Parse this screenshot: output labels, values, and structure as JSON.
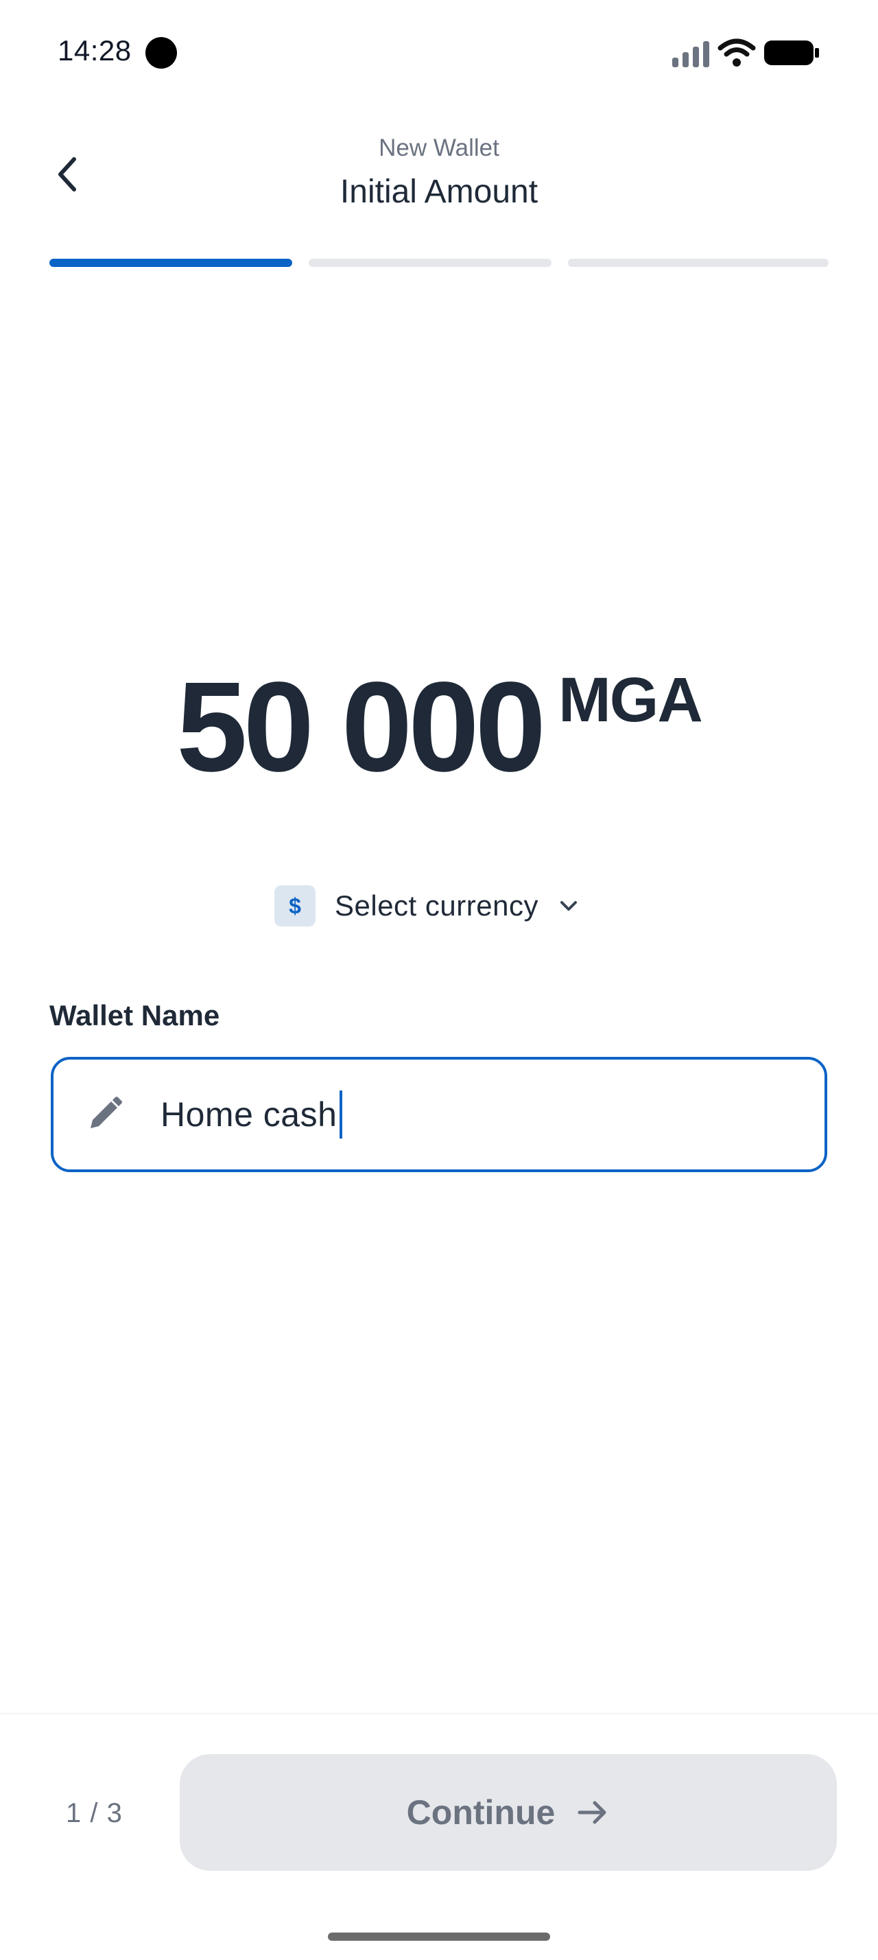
{
  "status_bar": {
    "time": "14:28"
  },
  "header": {
    "subtitle": "New Wallet",
    "title": "Initial Amount"
  },
  "progress": {
    "current_step": 1,
    "total_steps": 3
  },
  "amount": {
    "value": "50 000",
    "currency": "MGA"
  },
  "currency_selector": {
    "icon_symbol": "$",
    "label": "Select currency"
  },
  "wallet_name": {
    "label": "Wallet Name",
    "value": "Home cash"
  },
  "footer": {
    "step_counter": "1 / 3",
    "continue_label": "Continue"
  },
  "colors": {
    "accent": "#0b63c5",
    "text": "#1f2937",
    "muted": "#6b7280",
    "disabled_bg": "#e5e7eb"
  },
  "icons": [
    "back-arrow-icon",
    "signal-icon",
    "wifi-icon",
    "battery-icon",
    "currency-dollar-icon",
    "chevron-down-icon",
    "pencil-icon",
    "arrow-right-icon"
  ]
}
